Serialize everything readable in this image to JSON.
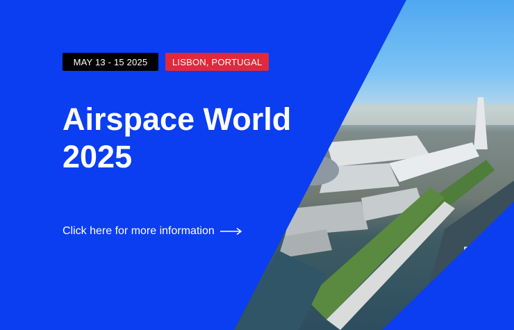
{
  "event": {
    "date_label": "MAY 13 - 15 2025",
    "location_label": "LISBON, PORTUGAL",
    "title": "Airspace World 2025",
    "cta_label": "Click here for more information"
  },
  "colors": {
    "background": "#0a3ef0",
    "date_badge": "#000000",
    "location_badge": "#e1293a",
    "text": "#ffffff"
  },
  "icons": {
    "cta_arrow": "arrow-right-icon",
    "photo": "aerial-city-photo"
  }
}
